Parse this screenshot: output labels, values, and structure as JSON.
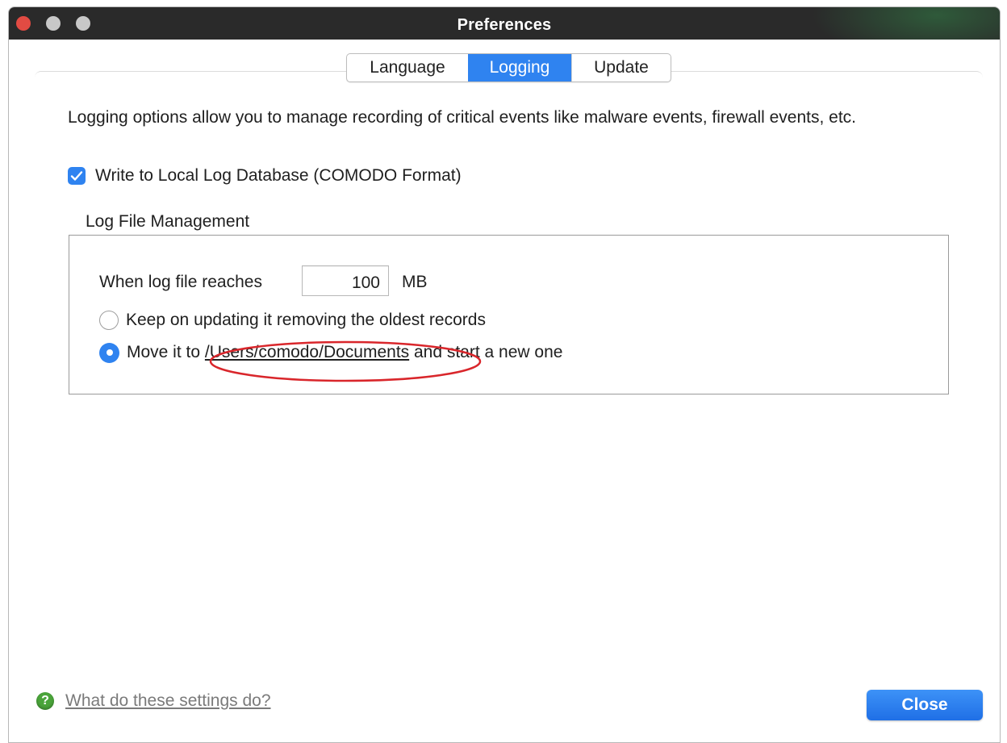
{
  "window": {
    "title": "Preferences"
  },
  "tabs": [
    {
      "label": "Language",
      "active": false
    },
    {
      "label": "Logging",
      "active": true
    },
    {
      "label": "Update",
      "active": false
    }
  ],
  "logging": {
    "description": "Logging options allow you to manage recording of critical events like malware events, firewall events, etc.",
    "write_local_db": {
      "label": "Write to Local Log Database (COMODO Format)",
      "checked": true
    },
    "group_title": "Log File Management",
    "reach_label": "When log file reaches",
    "size_value": "100",
    "size_unit": "MB",
    "option_keep": {
      "label": "Keep on updating it removing the oldest records",
      "selected": false
    },
    "option_move": {
      "prefix": "Move it to",
      "path": "/Users/comodo/Documents",
      "suffix": "and start a new one",
      "selected": true
    }
  },
  "footer": {
    "help_link": "What do these settings do?",
    "close_label": "Close"
  },
  "colors": {
    "accent": "#2f83f0",
    "annotation": "#d9262b",
    "help_icon": "#4aa43a"
  }
}
